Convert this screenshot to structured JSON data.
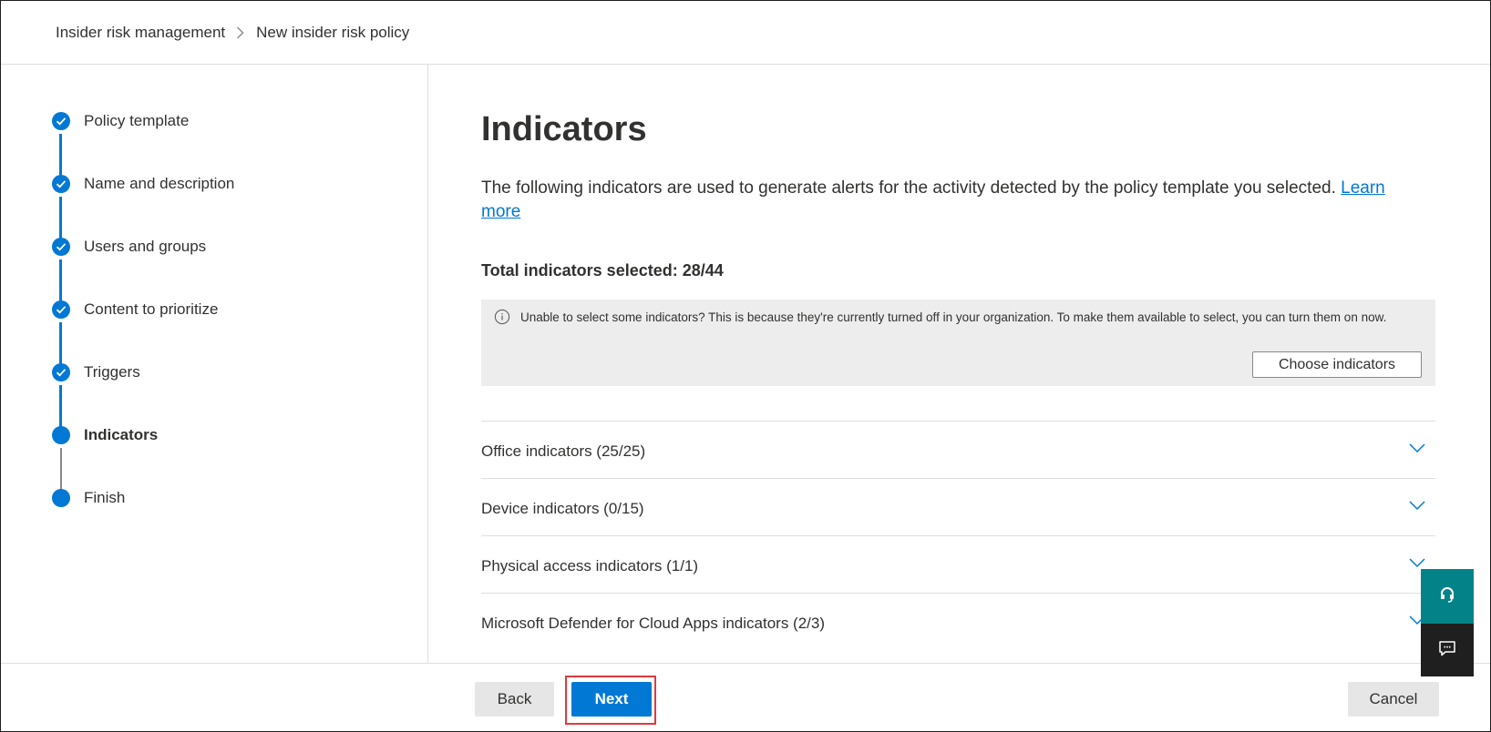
{
  "breadcrumb": {
    "items": [
      "Insider risk management",
      "New insider risk policy"
    ]
  },
  "steps": [
    {
      "label": "Policy template",
      "state": "completed"
    },
    {
      "label": "Name and description",
      "state": "completed"
    },
    {
      "label": "Users and groups",
      "state": "completed"
    },
    {
      "label": "Content to prioritize",
      "state": "completed"
    },
    {
      "label": "Triggers",
      "state": "completed"
    },
    {
      "label": "Indicators",
      "state": "current"
    },
    {
      "label": "Finish",
      "state": "upcoming"
    }
  ],
  "main": {
    "title": "Indicators",
    "description": "The following indicators are used to generate alerts for the activity detected by the policy template you selected.",
    "learn_more": "Learn more",
    "total_selected": "Total indicators selected: 28/44",
    "info": {
      "text": "Unable to select some indicators? This is because they're currently turned off in your organization. To make them available to select, you can turn them on now.",
      "button": "Choose indicators"
    },
    "sections": [
      {
        "label": "Office indicators (25/25)"
      },
      {
        "label": "Device indicators (0/15)"
      },
      {
        "label": "Physical access indicators (1/1)"
      },
      {
        "label": "Microsoft Defender for Cloud Apps indicators (2/3)"
      }
    ]
  },
  "footer": {
    "back": "Back",
    "next": "Next",
    "cancel": "Cancel"
  },
  "colors": {
    "accent": "#0078d4",
    "highlight": "#e0393e",
    "help_widget": "#038387",
    "feedback_widget": "#1f1f1f"
  }
}
